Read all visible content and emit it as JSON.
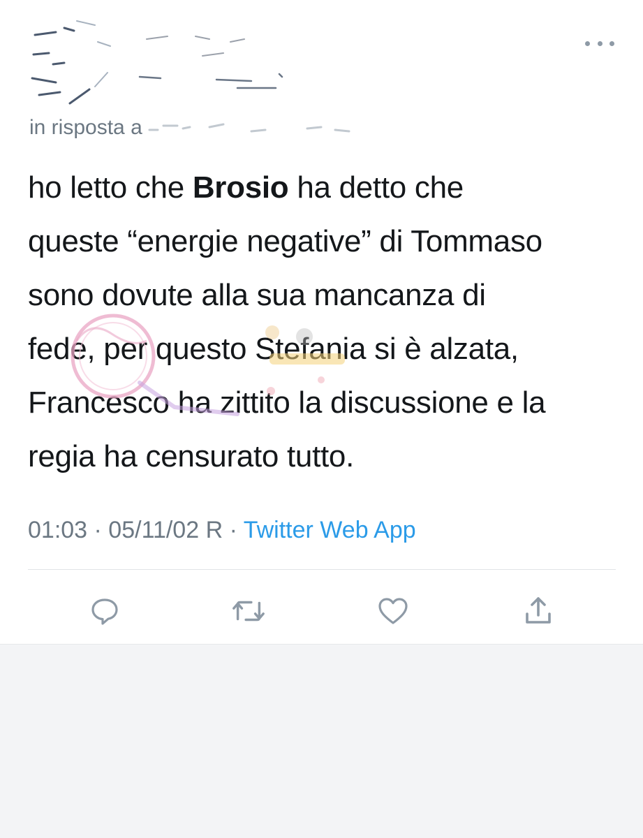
{
  "tweet": {
    "reply_prefix": "in risposta a",
    "text_lines": [
      {
        "before": "ho letto che ",
        "bold": "Brosio",
        "after": " ha detto che"
      },
      {
        "before": "queste “energie negative” di Tommaso",
        "bold": "",
        "after": ""
      },
      {
        "before": "sono dovute alla sua mancanza di",
        "bold": "",
        "after": ""
      },
      {
        "before": "fede, per questo Stefania si è alzata,",
        "bold": "",
        "after": ""
      },
      {
        "before": "Francesco ha zittito la discussione e la",
        "bold": "",
        "after": ""
      },
      {
        "before": "regia ha censurato tutto.",
        "bold": "",
        "after": ""
      }
    ],
    "timestamp": "01:03 · 05/11/02 R",
    "separator": " · ",
    "source": "Twitter Web App"
  },
  "actions": {
    "reply_icon": "reply-icon",
    "retweet_icon": "retweet-icon",
    "like_icon": "heart-icon",
    "share_icon": "share-icon",
    "more_icon": "more-dots-icon"
  },
  "colors": {
    "text": "#14171a",
    "muted": "#6b7782",
    "link": "#2b9be8",
    "icon": "#8e9aa6",
    "watermark_pink": "#e9a6c4"
  }
}
